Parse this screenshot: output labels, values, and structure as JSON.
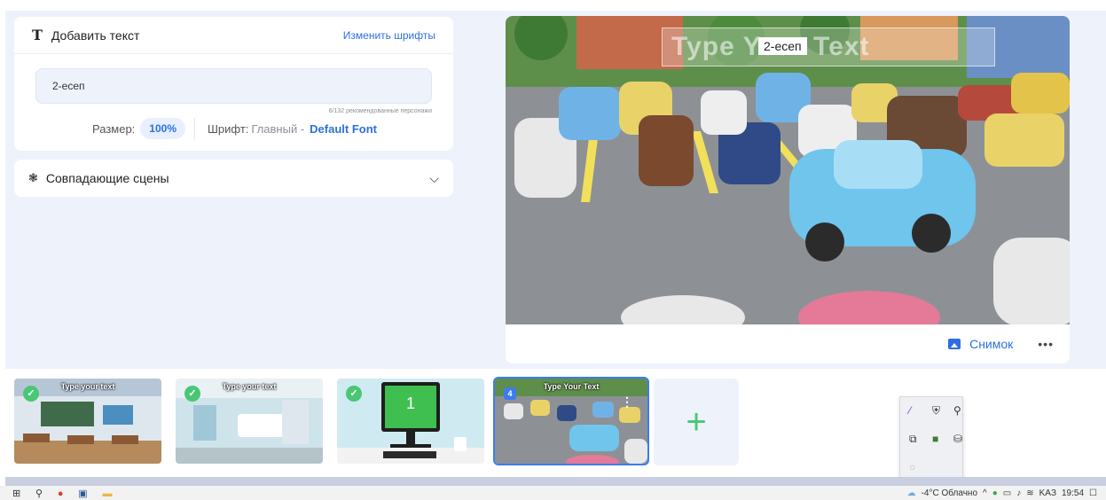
{
  "add_text": {
    "title": "Добавить текст",
    "change_fonts": "Изменить шрифты",
    "text_value": "2-есеп",
    "counter": "6/132 рекомендованные персонажи",
    "size_label": "Размер:",
    "size_value": "100%",
    "font_label": "Шрифт:",
    "font_value": "Главный -",
    "font_name": "Default Font"
  },
  "scenes": {
    "title": "Совпадающие сцены"
  },
  "preview": {
    "overlay_placeholder": "Type Your Text",
    "overlay_value": "2-есеп",
    "snapshot_label": "Снимок",
    "more": "•••"
  },
  "thumbnails": [
    {
      "title": "Type your text",
      "checked": true
    },
    {
      "title": "Type your text",
      "checked": true
    },
    {
      "title": "",
      "screen_number": "1",
      "checked": true
    },
    {
      "title": "Type Your Text",
      "badge": "4",
      "selected": true
    }
  ],
  "add_scene_label": "+",
  "taskbar": {
    "weather": "-4°C Облачно",
    "language": "KAЗ",
    "time": "19:54"
  },
  "colors": {
    "accent": "#2d6fe0",
    "green": "#48c774",
    "background": "#eef2fb"
  }
}
